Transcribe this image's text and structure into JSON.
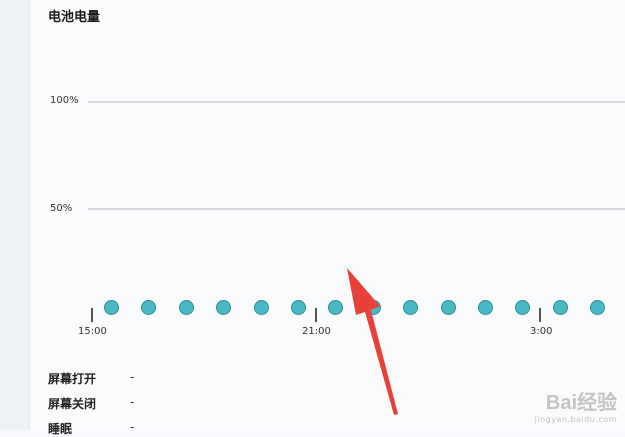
{
  "chart_data": {
    "type": "scatter",
    "title": "电池电量",
    "y_ticks": [
      "100%",
      "50%"
    ],
    "x_ticks": [
      "15:00",
      "21:00",
      "3:00"
    ],
    "grid": true,
    "point_count": 14,
    "point_color": "#4ab8c4"
  },
  "stats": [
    {
      "label": "屏幕打开",
      "value": "-"
    },
    {
      "label": "屏幕关闭",
      "value": "-"
    },
    {
      "label": "睡眠",
      "value": "-"
    }
  ],
  "annotation": {
    "type": "arrow",
    "color": "#e8413a"
  },
  "watermark": {
    "main": "Bai经验",
    "sub": "jingyan.baidu.com"
  }
}
